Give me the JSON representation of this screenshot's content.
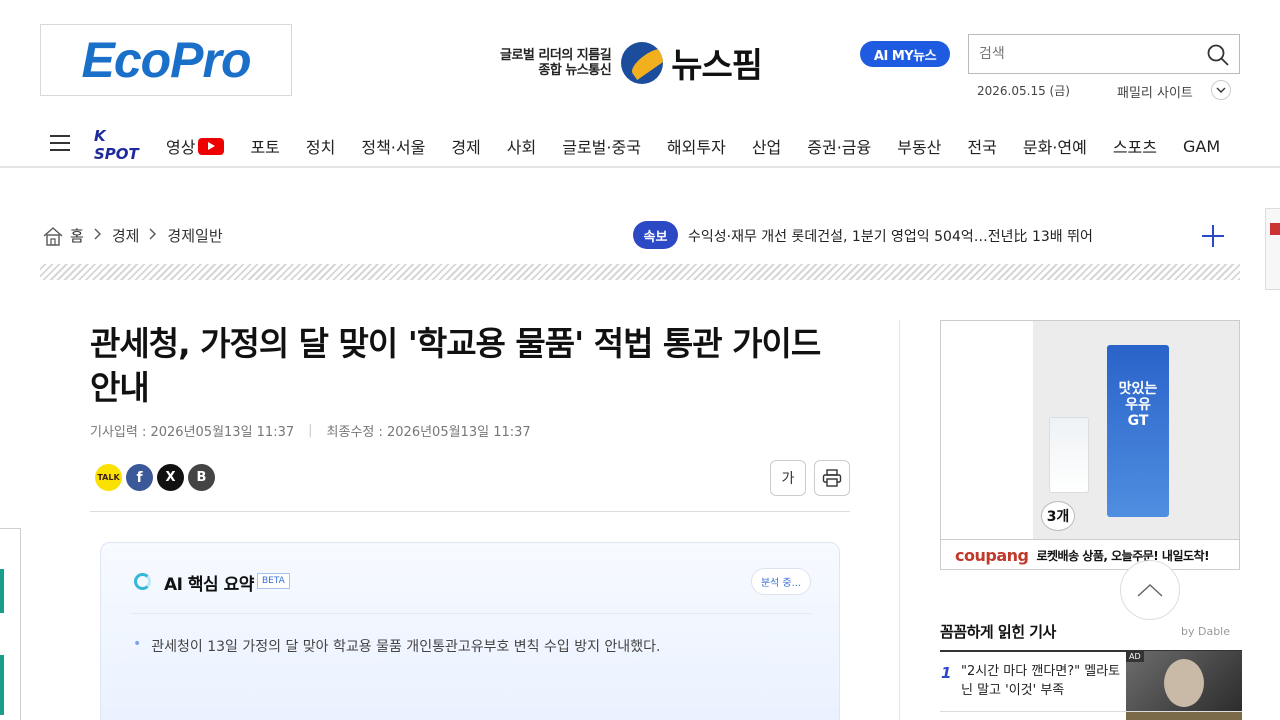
{
  "header": {
    "logo": "EcoPro",
    "brand_tagline_1": "글로벌 리더의 지름길",
    "brand_tagline_2": "종합 뉴스통신",
    "brand_name": "뉴스핌",
    "ai_button": "AI MY뉴스",
    "search_placeholder": "검색",
    "date": "2026.05.15 (금)",
    "family_site": "패밀리 사이트"
  },
  "nav": {
    "kspot": "K SPOT",
    "items": [
      "영상",
      "포토",
      "정치",
      "정책·서울",
      "경제",
      "사회",
      "글로벌·중국",
      "해외투자",
      "산업",
      "증권·금융",
      "부동산",
      "전국",
      "문화·연예",
      "스포츠",
      "GAM"
    ]
  },
  "breadcrumb": {
    "home": "홈",
    "level1": "경제",
    "level2": "경제일반"
  },
  "breaking": {
    "badge": "속보",
    "text": "수익성·재무 개선 롯데건설, 1분기 영업익 504억…전년比 13배 뛰어"
  },
  "article": {
    "title": "관세청, 가정의 달 맞이 '학교용 물품' 적법 통관 가이드 안내",
    "published": "기사입력 : 2026년05월13일 11:37",
    "updated": "최종수정 : 2026년05월13일 11:37",
    "font_size_btn": "가",
    "share": {
      "kakao": "TALK",
      "facebook": "f",
      "x": "X",
      "blog": "B"
    }
  },
  "ai_summary": {
    "title": "AI 핵심 요약",
    "beta": "BETA",
    "status": "분석 중...",
    "bullets": [
      "관세청이 13일 가정의 달 맞아 학교용 물품 개인통관고유부호 변칙 수입 방지 안내했다."
    ]
  },
  "ad": {
    "product_label": "맛있는 우유 GT",
    "count": "3개",
    "brand": "coupang",
    "copy": "로켓배송 상품, 오늘주문! 내일도착!"
  },
  "most_read": {
    "title": "꼼꼼하게 읽힌 기사",
    "provider": "by Dable",
    "items": [
      {
        "rank": "1",
        "text": "\"2시간 마다 깬다면?\" 멜라토닌 말고 '이것' 부족",
        "ad": "AD"
      }
    ]
  },
  "colors": {
    "accent": "#2b49c4",
    "ai_button": "#1f5be0",
    "logo": "#1a6fc9",
    "youtube": "#ee0000"
  }
}
